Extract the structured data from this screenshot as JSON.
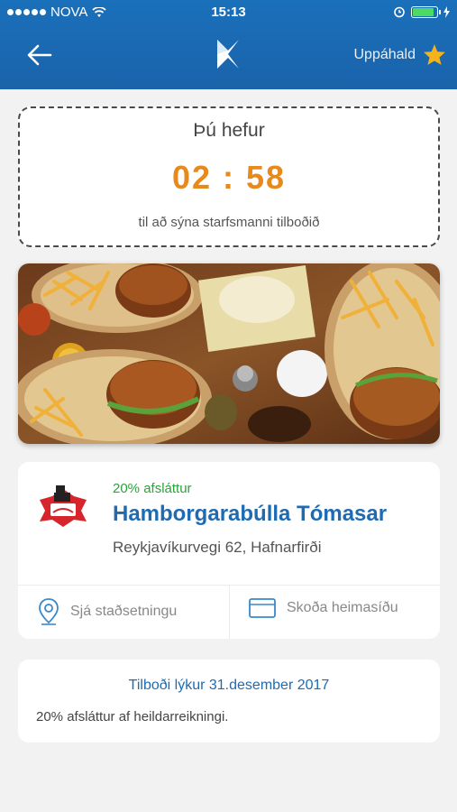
{
  "status": {
    "carrier": "NOVA",
    "time": "15:13",
    "battery_level": 0.9
  },
  "header": {
    "right_label": "Uppáhald",
    "back_icon": "arrow-left-icon",
    "star_icon": "star-icon",
    "star_color": "#f5b31b"
  },
  "timer": {
    "title": "Þú hefur",
    "value": "02 : 58",
    "subtitle": "til að sýna starfsmanni tilboðið",
    "accent": "#e8891c"
  },
  "venue": {
    "discount": "20% afsláttur",
    "name": "Hamborgarabúlla Tómasar",
    "address": "Reykjavíkurvegi 62, Hafnarfirði",
    "location_label": "Sjá staðsetningu",
    "website_label": "Skoða heimasíðu"
  },
  "offer": {
    "ends": "Tilboði lýkur 31.desember 2017",
    "description": "20% afsláttur af heildarreikningi."
  }
}
